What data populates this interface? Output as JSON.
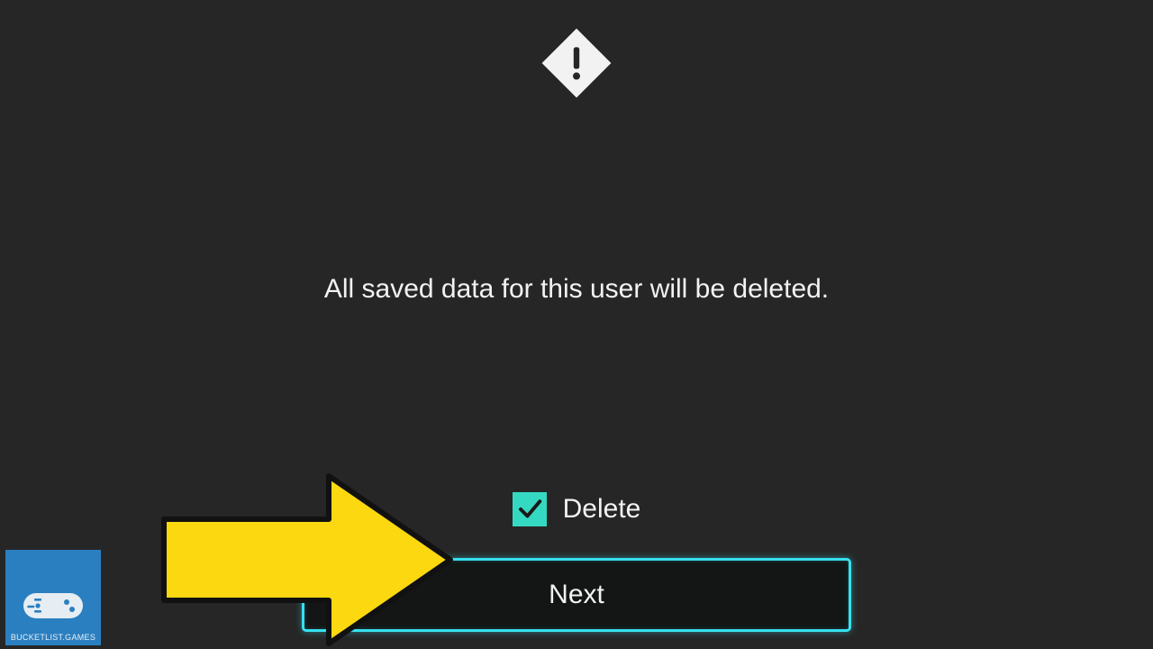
{
  "message": "All saved data for this user will be deleted.",
  "checkbox": {
    "label": "Delete",
    "checked": true
  },
  "button": {
    "next_label": "Next"
  },
  "badge": {
    "text": "BUCKETLIST.GAMES"
  },
  "colors": {
    "accent_checkbox": "#35d9c2",
    "accent_focus": "#37e0ef",
    "arrow": "#fbd80f",
    "badge_bg": "#2a7fc0"
  }
}
